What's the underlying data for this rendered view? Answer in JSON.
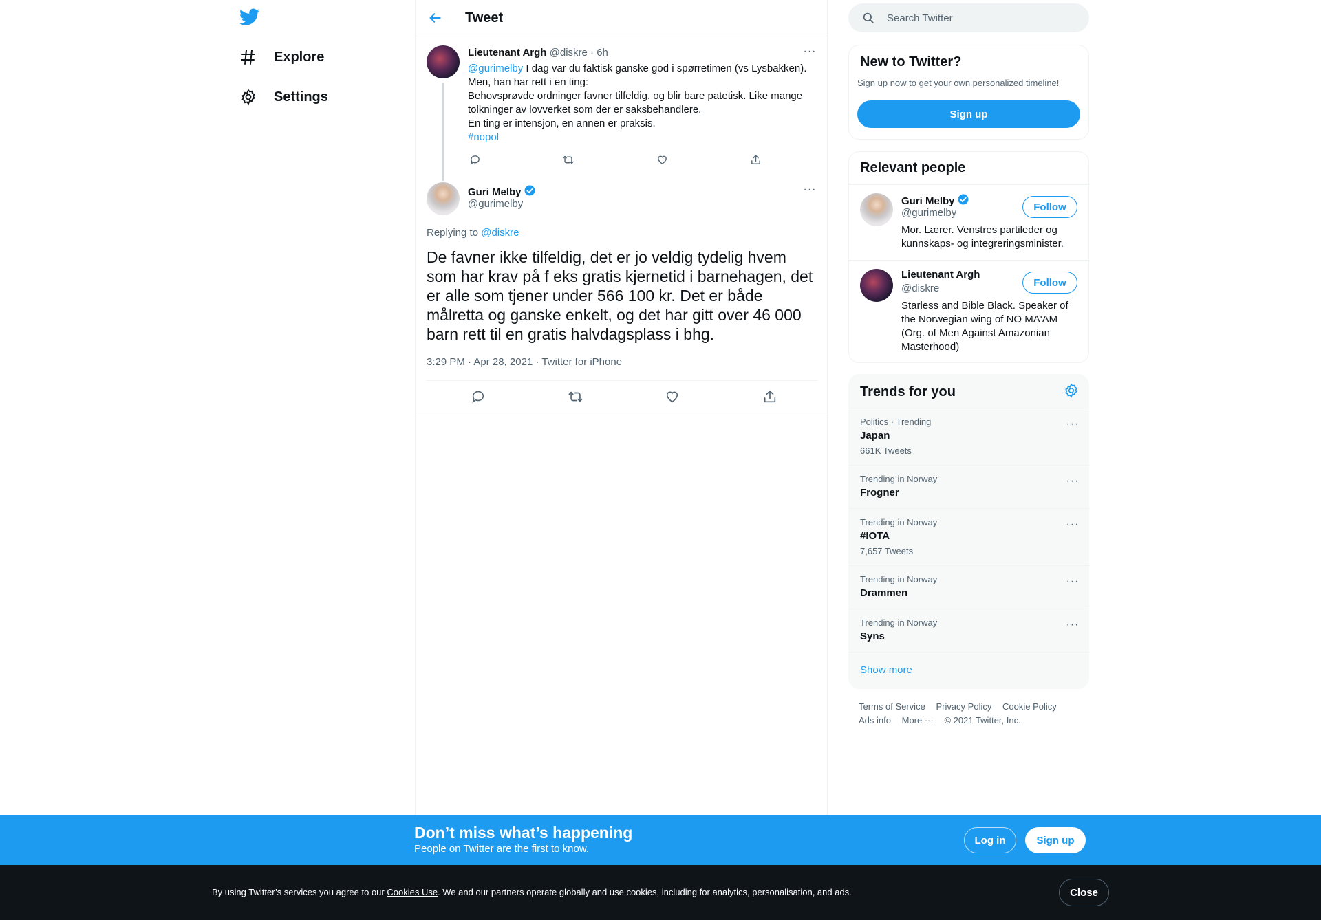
{
  "nav": {
    "items": [
      {
        "label": "Explore",
        "icon": "hashtag-icon"
      },
      {
        "label": "Settings",
        "icon": "gear-icon"
      }
    ]
  },
  "header": {
    "title": "Tweet"
  },
  "parent_tweet": {
    "name": "Lieutenant Argh",
    "handle": "@diskre",
    "dot": "·",
    "time": "6h",
    "mention": "@gurimelby",
    "text_after_mention": " I dag var du faktisk ganske god i spørretimen (vs Lysbakken).",
    "lines": [
      "Men, han har rett i en ting:",
      "Behovsprøvde ordninger favner tilfeldig, og blir bare patetisk. Like mange tolkninger av lovverket som der er saksbehandlere.",
      "En ting er intensjon, en annen er praksis."
    ],
    "hashtag": "#nopol"
  },
  "main_tweet": {
    "name": "Guri Melby",
    "handle": "@gurimelby",
    "replying_prefix": "Replying to ",
    "replying_handle": "@diskre",
    "text": "De favner ikke tilfeldig, det er jo veldig tydelig hvem som har krav på f eks gratis kjernetid i barnehagen, det er alle som tjener under 566 100 kr. Det er både målretta og ganske enkelt, og det har gitt over 46 000 barn rett til en gratis halvdagsplass i bhg.",
    "meta": "3:29 PM · Apr 28, 2021 · Twitter for iPhone"
  },
  "search": {
    "placeholder": "Search Twitter"
  },
  "new_to_twitter": {
    "title": "New to Twitter?",
    "subtitle": "Sign up now to get your own personalized timeline!",
    "button": "Sign up"
  },
  "relevant_people": {
    "title": "Relevant people",
    "people": [
      {
        "name": "Guri Melby",
        "handle": "@gurimelby",
        "bio": "Mor. Lærer. Venstres partileder og kunnskaps- og integreringsminister.",
        "follow": "Follow"
      },
      {
        "name": "Lieutenant Argh",
        "handle": "@diskre",
        "bio": "Starless and Bible Black. Speaker of the Norwegian wing of NO MA'AM (Org. of Men Against Amazonian Masterhood)",
        "follow": "Follow"
      }
    ]
  },
  "trends": {
    "title": "Trends for you",
    "items": [
      {
        "context": "Politics · Trending",
        "name": "Japan",
        "count": "661K Tweets"
      },
      {
        "context": "Trending in Norway",
        "name": "Frogner",
        "count": ""
      },
      {
        "context": "Trending in Norway",
        "name": "#IOTA",
        "count": "7,657 Tweets"
      },
      {
        "context": "Trending in Norway",
        "name": "Drammen",
        "count": ""
      },
      {
        "context": "Trending in Norway",
        "name": "Syns",
        "count": ""
      }
    ],
    "show_more": "Show more"
  },
  "footer": {
    "links": [
      "Terms of Service",
      "Privacy Policy",
      "Cookie Policy",
      "Ads info",
      "More ···",
      "© 2021 Twitter, Inc."
    ]
  },
  "promo": {
    "title": "Don’t miss what’s happening",
    "subtitle": "People on Twitter are the first to know.",
    "login": "Log in",
    "signup": "Sign up"
  },
  "cookie": {
    "prefix": "By using Twitter’s services you agree to our ",
    "link": "Cookies Use",
    "suffix": ". We and our partners operate globally and use cookies, including for analytics, personalisation, and ads.",
    "close": "Close"
  },
  "colors": {
    "accent": "#1d9bf0",
    "text": "#0f1419",
    "secondary": "#536471",
    "cookie_bg": "#0f1419"
  }
}
